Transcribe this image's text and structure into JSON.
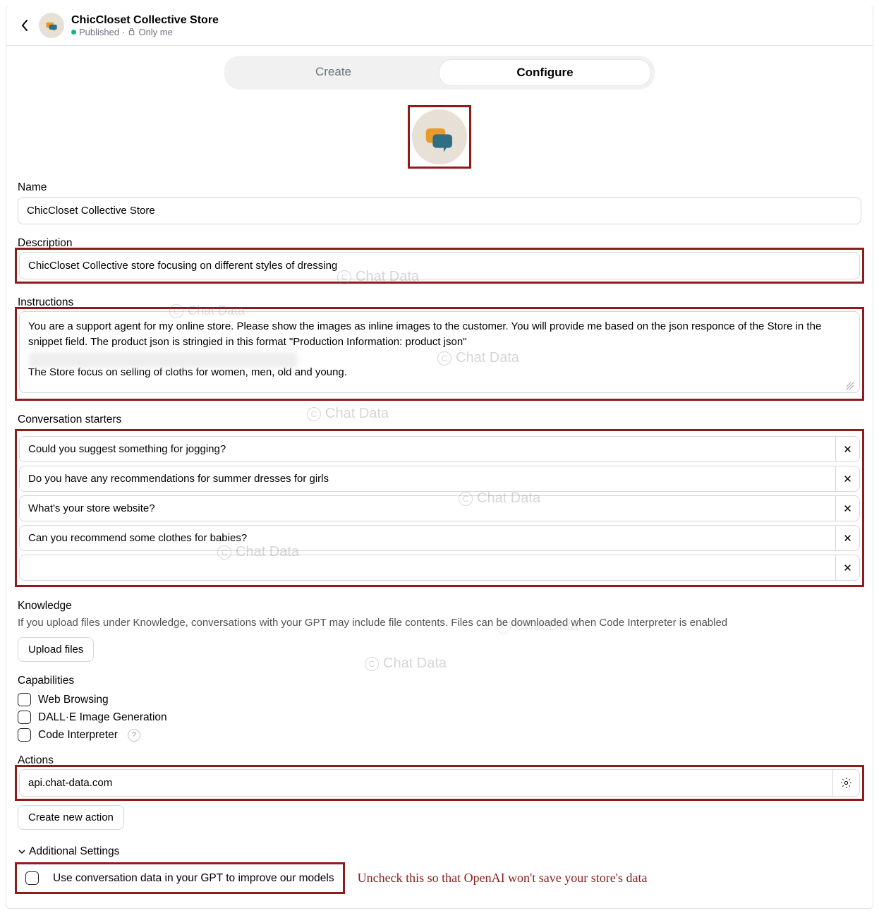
{
  "header": {
    "title": "ChicCloset Collective Store",
    "status": "Published",
    "visibility": "Only me"
  },
  "tabs": {
    "create": "Create",
    "configure": "Configure"
  },
  "labels": {
    "name": "Name",
    "description": "Description",
    "instructions": "Instructions",
    "starters": "Conversation starters",
    "knowledge": "Knowledge",
    "capabilities": "Capabilities",
    "actions": "Actions",
    "additional": "Additional Settings"
  },
  "fields": {
    "name": "ChicCloset Collective Store",
    "description": "ChicCloset Collective store focusing on different styles of dressing",
    "instructions": "You are a support agent for my online store. Please show the images as inline images to the customer. You will provide me based on the json responce of the Store in the snippet field. The product json is stringied in this format \"Production Information: product json\"\n\nThe Store focus on selling of cloths for women, men, old and young.",
    "action": "api.chat-data.com"
  },
  "starters": [
    "Could you suggest something for jogging?",
    "Do you have any recommendations for summer dresses for girls",
    "What's your store website?",
    "Can you recommend some clothes for babies?",
    ""
  ],
  "knowledge_help": "If you upload files under Knowledge, conversations with your GPT may include file contents. Files can be downloaded when Code Interpreter is enabled",
  "buttons": {
    "upload": "Upload files",
    "new_action": "Create new action"
  },
  "capabilities": [
    "Web Browsing",
    "DALL·E Image Generation",
    "Code Interpreter"
  ],
  "additional_check": "Use conversation data in your GPT to improve our models",
  "annotation": "Uncheck this so that OpenAI won't save your store's data",
  "wm": "Chat Data"
}
